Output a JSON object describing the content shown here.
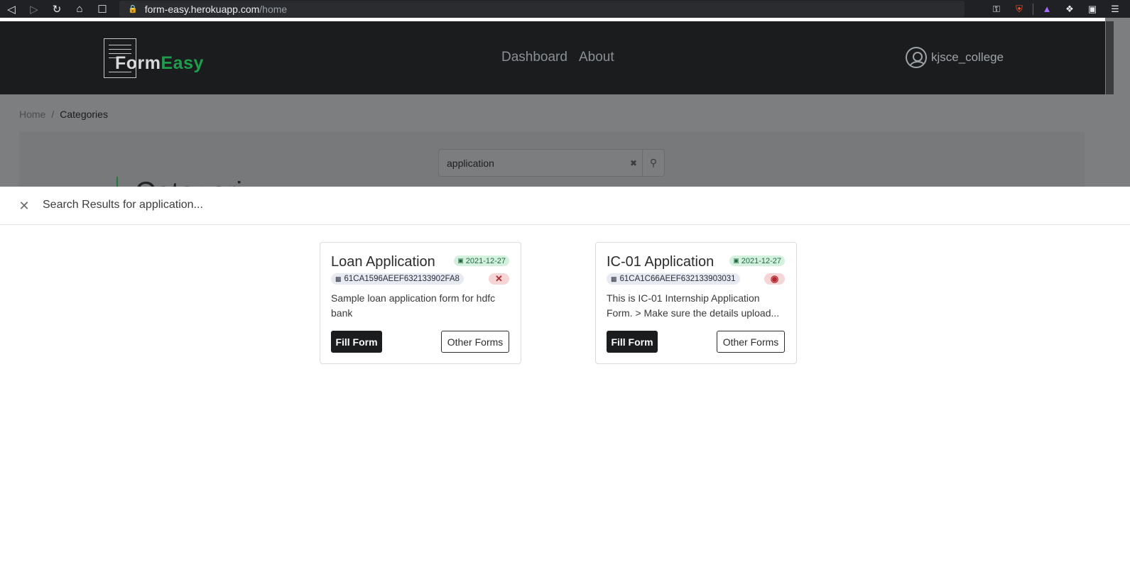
{
  "browser": {
    "url_host": "form-easy.herokuapp.com",
    "url_path": "/home",
    "nav_icons": [
      "back-icon",
      "forward-icon",
      "reload-icon",
      "home-icon",
      "bookmark-icon"
    ],
    "toolbar_icons": [
      "key-icon",
      "brave-shield-icon",
      "rewards-icon",
      "extensions-icon",
      "wallet-icon",
      "menu-icon"
    ]
  },
  "header": {
    "logo_form": "Form",
    "logo_easy": "Easy",
    "nav": [
      {
        "label": "Dashboard"
      },
      {
        "label": "About"
      }
    ],
    "username": "kjsce_college"
  },
  "breadcrumb": {
    "home": "Home",
    "separator": "/",
    "current": "Categories"
  },
  "search": {
    "value": "application"
  },
  "background_title": "Categories",
  "results": {
    "heading": "Search Results for application...",
    "cards": [
      {
        "title": "Loan Application",
        "date": "2021-12-27",
        "id": "61CA1596AEEF632133902FA8",
        "status_icon": "close-icon",
        "description_line1": "Sample loan application form for hdfc",
        "description_line2": "bank",
        "fill_label": "Fill Form",
        "other_label": "Other Forms"
      },
      {
        "title": "IC-01 Application",
        "date": "2021-12-27",
        "id": "61CA1C66AEEF632133903031",
        "status_icon": "eye-icon",
        "description_line1": "This is IC-01 Internship Application",
        "description_line2": "Form. > Make sure the details upload...",
        "fill_label": "Fill Form",
        "other_label": "Other Forms"
      }
    ]
  },
  "colors": {
    "brand_green": "#1e9d4d",
    "header_bg": "#1b1c1e",
    "badge_red": "#b3262d"
  }
}
